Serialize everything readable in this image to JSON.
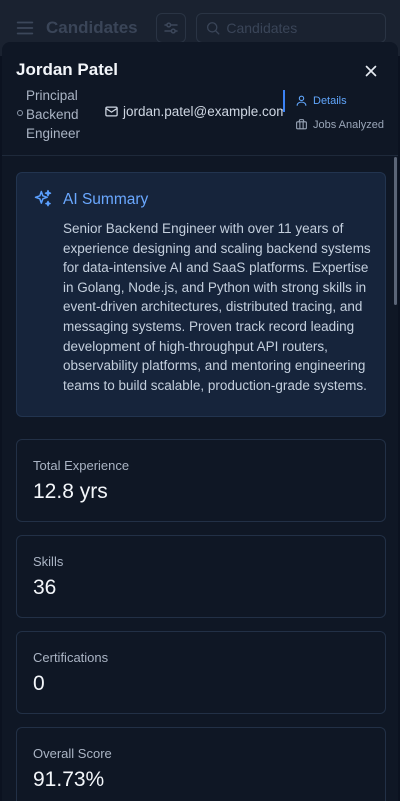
{
  "appbar": {
    "title": "Candidates",
    "search_placeholder": "Candidates",
    "icons": [
      "hamburger-menu-icon",
      "sliders-icon",
      "search-icon"
    ]
  },
  "candidate": {
    "name": "Jordan Patel",
    "role": "Principal Backend Engineer",
    "email": "jordan.patel@example.com"
  },
  "tabs": {
    "details": "Details",
    "jobs_analyzed": "Jobs Analyzed"
  },
  "summary": {
    "title": "AI Summary",
    "text": "Senior Backend Engineer with over 11 years of experience designing and scaling backend systems for data-intensive AI and SaaS platforms. Expertise in Golang, Node.js, and Python with strong skills in event-driven architectures, distributed tracing, and messaging systems. Proven track record leading development of high-throughput API routers, observability platforms, and mentoring engineering teams to build scalable, production-grade systems."
  },
  "stats": [
    {
      "label": "Total Experience",
      "value": "12.8 yrs"
    },
    {
      "label": "Skills",
      "value": "36"
    },
    {
      "label": "Certifications",
      "value": "0"
    },
    {
      "label": "Overall Score",
      "value": "91.73%"
    }
  ],
  "colors": {
    "accent": "#60a5fa",
    "background": "#0b1220",
    "panel": "#0f1725",
    "summary_bg": "#16243b"
  }
}
